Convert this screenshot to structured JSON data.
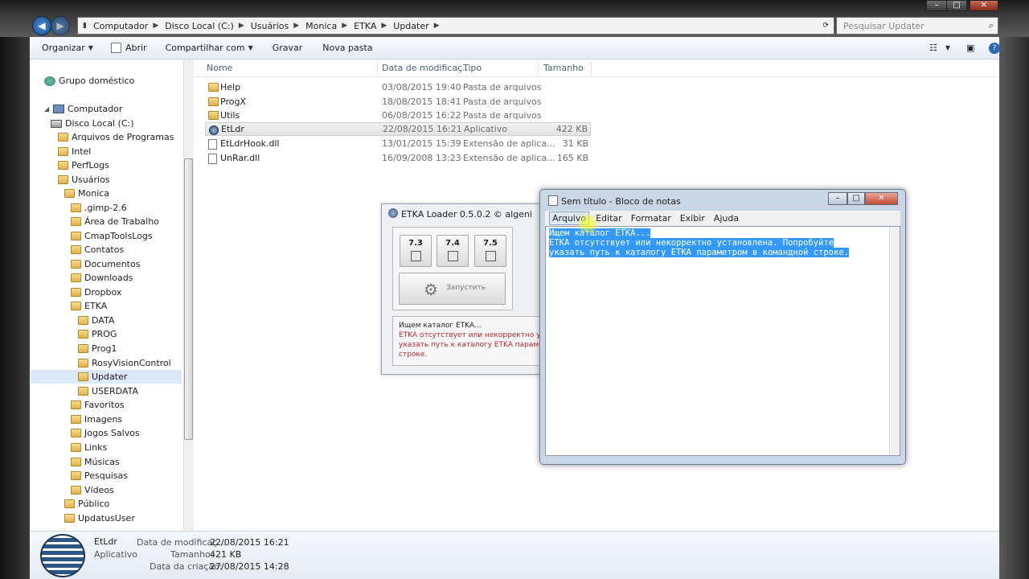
{
  "address_bar": {
    "crumbs": [
      "Computador",
      "Disco Local (C:)",
      "Usuários",
      "Monica",
      "ETKA",
      "Updater"
    ],
    "search_placeholder": "Pesquisar Updater"
  },
  "toolbar": {
    "organize": "Organizar",
    "open": "Abrir",
    "share": "Compartilhar com",
    "burn": "Gravar",
    "new_folder": "Nova pasta"
  },
  "nav": {
    "items": [
      {
        "label": "Grupo doméstico",
        "icon": "homegroup-icon"
      },
      {
        "label": "Computador",
        "icon": "computer-icon"
      },
      {
        "label": "Disco Local (C:)",
        "icon": "disk-icon"
      },
      {
        "label": "Arquivos de Programas",
        "icon": "folder-icon"
      },
      {
        "label": "Intel",
        "icon": "folder-icon"
      },
      {
        "label": "PerfLogs",
        "icon": "folder-icon"
      },
      {
        "label": "Usuários",
        "icon": "folder-icon"
      },
      {
        "label": "Monica",
        "icon": "folder-icon"
      },
      {
        "label": ".gimp-2.6",
        "icon": "folder-icon"
      },
      {
        "label": "Área de Trabalho",
        "icon": "folder-icon"
      },
      {
        "label": "CmapToolsLogs",
        "icon": "folder-icon"
      },
      {
        "label": "Contatos",
        "icon": "folder-icon"
      },
      {
        "label": "Documentos",
        "icon": "folder-icon"
      },
      {
        "label": "Downloads",
        "icon": "folder-icon"
      },
      {
        "label": "Dropbox",
        "icon": "folder-icon"
      },
      {
        "label": "ETKA",
        "icon": "folder-icon"
      },
      {
        "label": "DATA",
        "icon": "folder-icon"
      },
      {
        "label": "PROG",
        "icon": "folder-icon"
      },
      {
        "label": "Prog1",
        "icon": "folder-icon"
      },
      {
        "label": "RosyVisionControl",
        "icon": "folder-icon"
      },
      {
        "label": "Updater",
        "icon": "folder-icon"
      },
      {
        "label": "USERDATA",
        "icon": "folder-icon"
      },
      {
        "label": "Favoritos",
        "icon": "folder-icon"
      },
      {
        "label": "Imagens",
        "icon": "folder-icon"
      },
      {
        "label": "Jogos Salvos",
        "icon": "folder-icon"
      },
      {
        "label": "Links",
        "icon": "folder-icon"
      },
      {
        "label": "Músicas",
        "icon": "folder-icon"
      },
      {
        "label": "Pesquisas",
        "icon": "folder-icon"
      },
      {
        "label": "Vídeos",
        "icon": "folder-icon"
      },
      {
        "label": "Público",
        "icon": "folder-icon"
      },
      {
        "label": "UpdatusUser",
        "icon": "folder-icon"
      }
    ]
  },
  "columns": {
    "name": "Nome",
    "date": "Data de modificaç...",
    "type": "Tipo",
    "size": "Tamanho"
  },
  "files": [
    {
      "name": "Help",
      "date": "03/08/2015 19:40",
      "type": "Pasta de arquivos",
      "size": "",
      "kind": "folder"
    },
    {
      "name": "ProgX",
      "date": "18/08/2015 18:41",
      "type": "Pasta de arquivos",
      "size": "",
      "kind": "folder"
    },
    {
      "name": "Utils",
      "date": "06/08/2015 16:22",
      "type": "Pasta de arquivos",
      "size": "",
      "kind": "folder"
    },
    {
      "name": "EtLdr",
      "date": "22/08/2015 16:21",
      "type": "Aplicativo",
      "size": "422 KB",
      "kind": "app"
    },
    {
      "name": "EtLdrHook.dll",
      "date": "13/01/2015 15:39",
      "type": "Extensão de aplica...",
      "size": "31 KB",
      "kind": "dll"
    },
    {
      "name": "UnRar.dll",
      "date": "16/09/2008 13:23",
      "type": "Extensão de aplica...",
      "size": "165 KB",
      "kind": "dll"
    }
  ],
  "details": {
    "name": "EtLdr",
    "kind": "Aplicativo",
    "modified_label": "Data de modificaç...",
    "modified": "22/08/2015 16:21",
    "size_label": "Tamanho:",
    "size": "421 KB",
    "created_label": "Data da criação:",
    "created": "27/08/2015 14:28"
  },
  "etka": {
    "title": "ETKA Loader 0.5.0.2 © algeni",
    "versions": [
      "7.3",
      "7.4",
      "7.5"
    ],
    "run_label": "Запустить",
    "msg_title": "Ищем каталог ETKA...",
    "msg_lines": [
      "ETKA отсутствует или некорректно уста...",
      "указать путь к каталогу ETKA параметр...",
      "строке."
    ]
  },
  "notepad": {
    "title": "Sem título - Bloco de notas",
    "menu": [
      "Arquivo",
      "Editar",
      "Formatar",
      "Exibir",
      "Ajuda"
    ],
    "lines": [
      "Ищем каталог ETKA...",
      "ETKA отсутствует или некорректно установлена. Попробуйте",
      "указать путь к каталогу ETKA параметром в командной строке."
    ]
  }
}
